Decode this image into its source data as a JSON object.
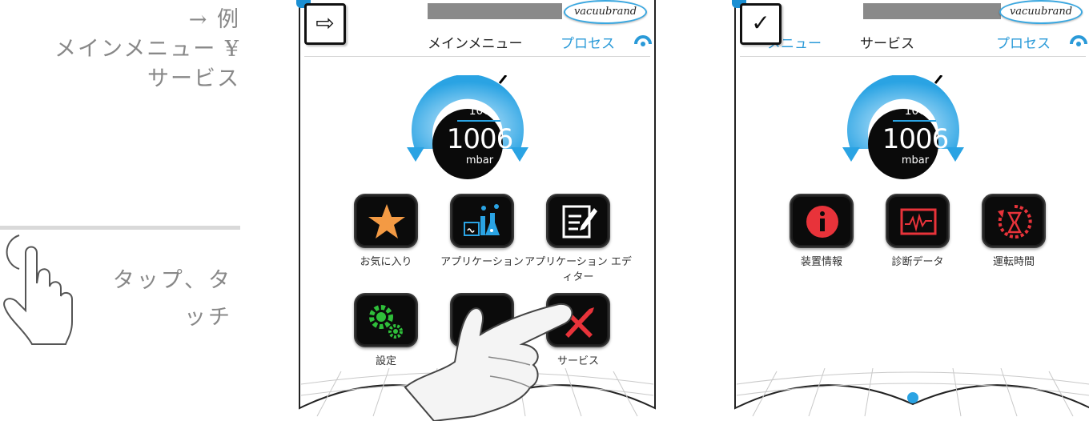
{
  "instruction": {
    "arrow": "→ 例",
    "path_line1": "メインメニュー ¥",
    "path_line2": "サービス",
    "tap_line1": "タップ、タ",
    "tap_line2": "ッチ"
  },
  "screen_a": {
    "mode_symbol": "⇨",
    "logo": "vacuubrand",
    "title": "メインメニュー",
    "process_label": "プロセス",
    "gauge": {
      "setpoint": "100",
      "value": "1006",
      "unit": "mbar"
    },
    "tiles": [
      {
        "label": "お気に入り",
        "icon": "star-icon"
      },
      {
        "label": "アプリケーション",
        "icon": "applications-icon"
      },
      {
        "label": "アプリケーション エディター",
        "icon": "edit-icon"
      },
      {
        "label": "設定",
        "icon": "gears-icon"
      },
      {
        "label": "",
        "icon": "unknown-icon"
      },
      {
        "label": "サービス",
        "icon": "tools-icon"
      }
    ]
  },
  "screen_b": {
    "mode_symbol": "✓",
    "logo": "vacuubrand",
    "breadcrumb": "メニュー",
    "title": "サービス",
    "process_label": "プロセス",
    "gauge": {
      "setpoint": "100",
      "value": "1006",
      "unit": "mbar"
    },
    "tiles": [
      {
        "label": "装置情報",
        "icon": "info-icon"
      },
      {
        "label": "診断データ",
        "icon": "diagnostics-icon"
      },
      {
        "label": "運転時間",
        "icon": "runtime-icon"
      }
    ]
  },
  "colors": {
    "accent": "#2aa3e3",
    "tile_bg": "#0b0b0b",
    "service_red": "#e8333a",
    "star": "#f39a44",
    "gear_green": "#2fbf3a"
  }
}
